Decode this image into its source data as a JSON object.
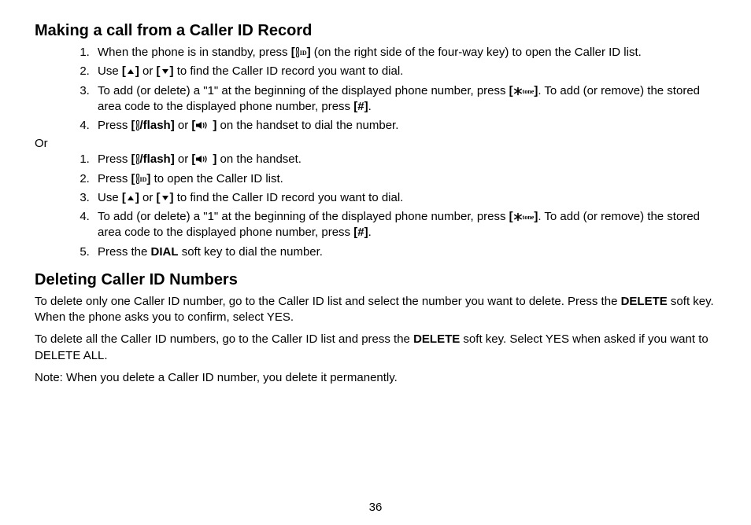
{
  "page_number": "36",
  "sections": {
    "making_call": {
      "heading": "Making a call from a Caller ID Record",
      "list_a": [
        {
          "pre": "When the phone is in standby, press ",
          "key": "cid",
          "post": " (on the right side of the four-way key) to open the Caller ID list."
        },
        {
          "pre": "Use ",
          "key": "up",
          "mid": " or ",
          "key2": "down",
          "post": " to find the Caller ID record you want to dial."
        },
        {
          "pre": "To add (or delete) a \"1\" at the beginning of the displayed phone number, press ",
          "key": "star",
          "post": ". To add (or remove) the stored area code to the displayed phone number, press ",
          "key2": "hash",
          "post2": "."
        },
        {
          "pre": "Press ",
          "key": "flash",
          "mid": " or ",
          "key2": "speaker",
          "post": " on the handset to dial the number."
        }
      ],
      "or_label": "Or",
      "list_b": [
        {
          "pre": "Press ",
          "key": "flash",
          "mid": " or ",
          "key2": "speaker",
          "post": " on the handset."
        },
        {
          "pre": "Press ",
          "key": "cid",
          "post": " to open the Caller ID list."
        },
        {
          "pre": "Use ",
          "key": "up",
          "mid": " or ",
          "key2": "down",
          "post": " to find the Caller ID record you want to dial."
        },
        {
          "pre": "To add (or delete) a \"1\" at the beginning of the displayed phone number, press ",
          "key": "star",
          "post": ". To add (or remove) the stored area code to the displayed phone number, press ",
          "key2": "hash",
          "post2": "."
        },
        {
          "pre": "Press the ",
          "bold": "DIAL",
          "post": " soft key to dial the number."
        }
      ]
    },
    "deleting": {
      "heading": "Deleting Caller ID Numbers",
      "p1_a": "To delete only one Caller ID number, go to the Caller ID list and select the number you want to delete. Press the ",
      "p1_bold": "DELETE",
      "p1_b": " soft key. When the phone asks you to confirm, select YES.",
      "p2_a": "To delete all the Caller ID numbers, go to the Caller ID list and press the ",
      "p2_bold": "DELETE",
      "p2_b": " soft key. Select YES when asked if you want to DELETE ALL.",
      "p3": "Note: When you delete a Caller ID number, you delete it permanently."
    }
  },
  "key_labels": {
    "flash_text": "/flash",
    "hash_text": "#",
    "cid_sub": "ID",
    "star_sub": "tone"
  }
}
